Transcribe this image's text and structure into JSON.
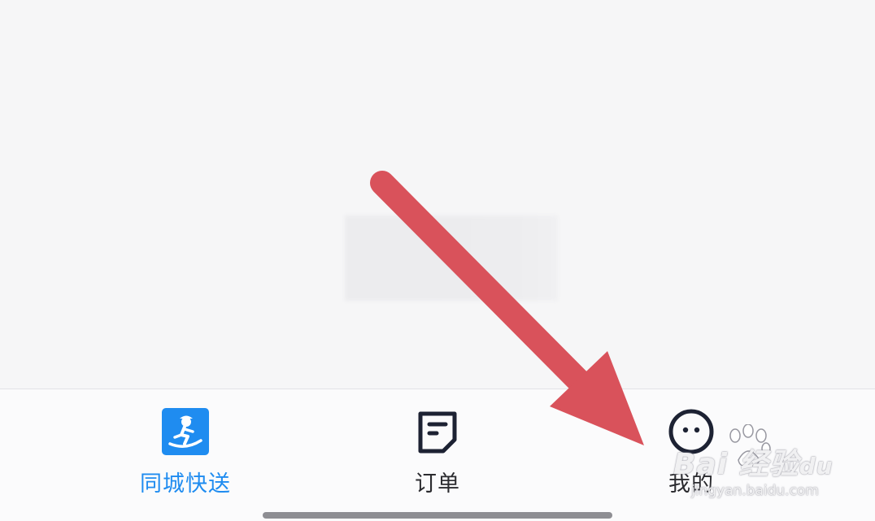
{
  "tab_bar": {
    "tabs": [
      {
        "label": "同城快送",
        "icon": "runner-icon",
        "active": true,
        "color": "#1f8cf0"
      },
      {
        "label": "订单",
        "icon": "order-note-icon",
        "active": false,
        "color": "#2b2b2f"
      },
      {
        "label": "我的",
        "icon": "face-icon",
        "active": false,
        "color": "#2b2b2f"
      }
    ]
  },
  "annotation": {
    "arrow_color": "#d9525b",
    "arrow_icon": "arrow-icon"
  },
  "watermark": {
    "brand": "Bai 经验",
    "brand_part2": "du",
    "url": "jingyan.baidu.com"
  },
  "colors": {
    "accent": "#1f8cf0",
    "background": "#f6f6f7",
    "tab_bar_bg": "#fbfbfc"
  }
}
